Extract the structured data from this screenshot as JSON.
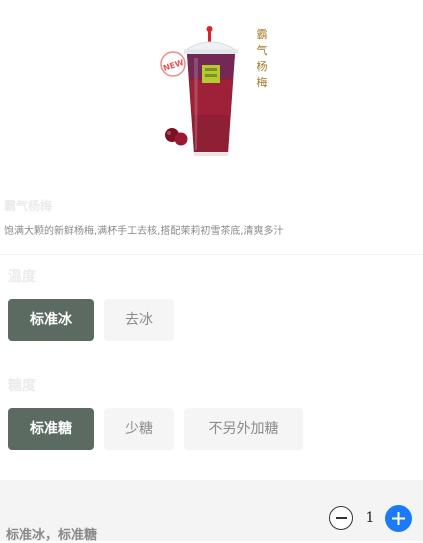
{
  "product": {
    "image_label": "霸气杨梅",
    "image_badge": "NEW",
    "name": "霸气杨梅",
    "description": "饱满大颗的新鲜杨梅,满杯手工去核,搭配茉莉初雪茶底,清爽多汁"
  },
  "temperature": {
    "title": "温度",
    "options": [
      {
        "label": "标准冰",
        "selected": true
      },
      {
        "label": "去冰",
        "selected": false
      }
    ]
  },
  "sweetness": {
    "title": "糖度",
    "options": [
      {
        "label": "标准糖",
        "selected": true
      },
      {
        "label": "少糖",
        "selected": false
      },
      {
        "label": "不另外加糖",
        "selected": false
      }
    ]
  },
  "cart": {
    "summary": "标准冰，标准糖",
    "quantity": "1",
    "minus_icon": "minus-circle-icon",
    "plus_icon": "plus-circle-icon"
  },
  "colors": {
    "selected_bg": "#5c6b62",
    "accent_blue": "#1a7af8",
    "drink": "#8e1f35"
  }
}
